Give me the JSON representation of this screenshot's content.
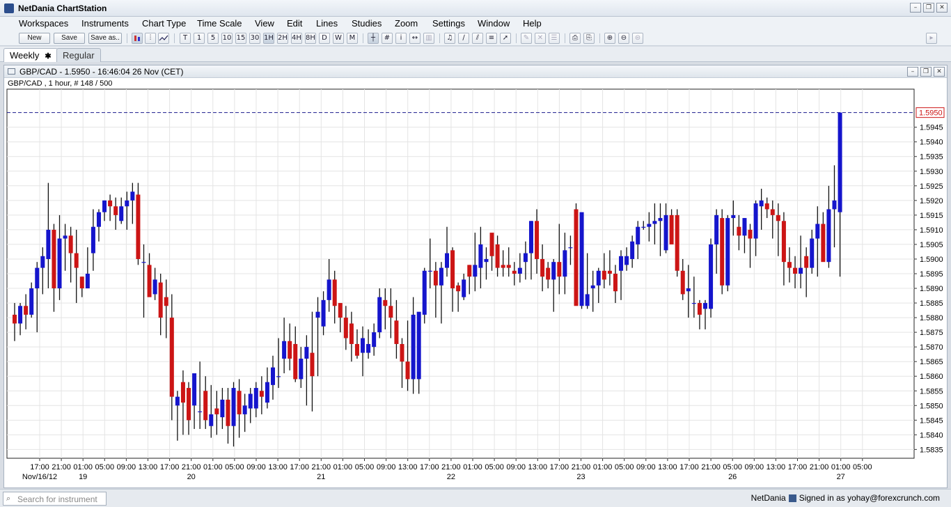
{
  "app": {
    "title": "NetDania ChartStation"
  },
  "window_controls": {
    "minimize": "–",
    "restore": "❐",
    "close": "✕"
  },
  "menu": [
    "Workspaces",
    "Instruments",
    "Chart Type",
    "Time Scale",
    "View",
    "Edit",
    "Lines",
    "Studies",
    "Zoom",
    "Settings",
    "Window",
    "Help"
  ],
  "toolbar": {
    "new_label": "New",
    "save_label": "Save",
    "save_as_label": "Save as..",
    "timeframes": [
      "T",
      "1",
      "5",
      "10",
      "15",
      "30",
      "1H",
      "2H",
      "4H",
      "8H",
      "D",
      "W",
      "M"
    ],
    "active_timeframe": "1H"
  },
  "tabs": [
    {
      "label": "Weekly",
      "close": "✱"
    },
    {
      "label": "Regular"
    }
  ],
  "chart_window": {
    "title": "GBP/CAD - 1.5950 - 16:46:04  26 Nov (CET)",
    "subtitle": "GBP/CAD , 1 hour, # 148 / 500"
  },
  "chart_data": {
    "type": "candlestick",
    "instrument": "GBP/CAD",
    "last_price": "1.5950",
    "up_color": "#1515cc",
    "down_color": "#cc1515",
    "ylim": [
      1.5832,
      1.5958
    ],
    "y_ticks": [
      "1.5945",
      "1.5940",
      "1.5935",
      "1.5930",
      "1.5925",
      "1.5920",
      "1.5915",
      "1.5910",
      "1.5905",
      "1.5900",
      "1.5895",
      "1.5890",
      "1.5885",
      "1.5880",
      "1.5875",
      "1.5870",
      "1.5865",
      "1.5860",
      "1.5855",
      "1.5850",
      "1.5845",
      "1.5840",
      "1.5835"
    ],
    "x_ticks": [
      "17:00",
      "21:00",
      "01:00",
      "05:00",
      "09:00",
      "13:00",
      "17:00",
      "21:00",
      "01:00",
      "05:00",
      "09:00",
      "13:00",
      "17:00",
      "21:00",
      "01:00",
      "05:00",
      "09:00",
      "13:00",
      "17:00",
      "21:00",
      "01:00",
      "05:00",
      "09:00",
      "13:00",
      "17:00",
      "21:00",
      "01:00",
      "05:00",
      "09:00",
      "13:00",
      "17:00",
      "21:00",
      "05:00",
      "09:00",
      "13:00",
      "17:00",
      "21:00",
      "01:00",
      "05:00"
    ],
    "date_labels": [
      {
        "label": "Nov/16/12",
        "tick": 0
      },
      {
        "label": "19",
        "tick": 2
      },
      {
        "label": "20",
        "tick": 7
      },
      {
        "label": "21",
        "tick": 13
      },
      {
        "label": "22",
        "tick": 19
      },
      {
        "label": "23",
        "tick": 25
      },
      {
        "label": "26",
        "tick": 32
      },
      {
        "label": "27",
        "tick": 37
      }
    ],
    "candles": [
      [
        1.5881,
        1.5885,
        1.5872,
        1.5878
      ],
      [
        1.5878,
        1.5885,
        1.5874,
        1.5884
      ],
      [
        1.5884,
        1.5888,
        1.5876,
        1.5881
      ],
      [
        1.5881,
        1.5892,
        1.588,
        1.589
      ],
      [
        1.589,
        1.5899,
        1.5875,
        1.5897
      ],
      [
        1.5897,
        1.5904,
        1.5888,
        1.5901
      ],
      [
        1.59,
        1.5926,
        1.589,
        1.591
      ],
      [
        1.591,
        1.5912,
        1.5882,
        1.589
      ],
      [
        1.589,
        1.5915,
        1.5886,
        1.5907
      ],
      [
        1.5907,
        1.5912,
        1.5896,
        1.5908
      ],
      [
        1.5908,
        1.5911,
        1.5892,
        1.5902
      ],
      [
        1.5902,
        1.591,
        1.5885,
        1.5897
      ],
      [
        1.5894,
        1.5894,
        1.5887,
        1.589
      ],
      [
        1.589,
        1.5904,
        1.589,
        1.5895
      ],
      [
        1.5902,
        1.5917,
        1.5896,
        1.5911
      ],
      [
        1.5911,
        1.5917,
        1.5906,
        1.5916
      ],
      [
        1.5916,
        1.592,
        1.5913,
        1.592
      ],
      [
        1.592,
        1.5922,
        1.5913,
        1.5918
      ],
      [
        1.5918,
        1.5921,
        1.591,
        1.5915
      ],
      [
        1.5913,
        1.5921,
        1.5912,
        1.5918
      ],
      [
        1.5918,
        1.5923,
        1.591,
        1.592
      ],
      [
        1.592,
        1.5926,
        1.5912,
        1.5923
      ],
      [
        1.5922,
        1.5926,
        1.5898,
        1.59
      ],
      [
        1.5899,
        1.5905,
        1.588,
        1.5899
      ],
      [
        1.5898,
        1.5902,
        1.5888,
        1.5887
      ],
      [
        1.5888,
        1.5897,
        1.5886,
        1.5893
      ],
      [
        1.5892,
        1.5895,
        1.5874,
        1.588
      ],
      [
        1.5887,
        1.5893,
        1.5873,
        1.5884
      ],
      [
        1.588,
        1.5888,
        1.5845,
        1.5853
      ],
      [
        1.585,
        1.5855,
        1.5838,
        1.5853
      ],
      [
        1.5858,
        1.5862,
        1.584,
        1.5851
      ],
      [
        1.5856,
        1.5858,
        1.584,
        1.5845
      ],
      [
        1.585,
        1.5855,
        1.5842,
        1.5861
      ],
      [
        1.5848,
        1.5865,
        1.5842,
        1.5848
      ],
      [
        1.5855,
        1.586,
        1.5842,
        1.5845
      ],
      [
        1.5843,
        1.5857,
        1.5839,
        1.5847
      ],
      [
        1.5849,
        1.5855,
        1.584,
        1.5847
      ],
      [
        1.5846,
        1.5856,
        1.5842,
        1.5852
      ],
      [
        1.5852,
        1.5856,
        1.5837,
        1.5843
      ],
      [
        1.5843,
        1.5858,
        1.5836,
        1.5856
      ],
      [
        1.5855,
        1.5859,
        1.5839,
        1.5847
      ],
      [
        1.5847,
        1.5854,
        1.5841,
        1.585
      ],
      [
        1.5849,
        1.5856,
        1.5844,
        1.5854
      ],
      [
        1.5849,
        1.5858,
        1.5846,
        1.5856
      ],
      [
        1.5855,
        1.586,
        1.5847,
        1.5853
      ],
      [
        1.5851,
        1.5863,
        1.5849,
        1.5858
      ],
      [
        1.5857,
        1.5867,
        1.5852,
        1.5863
      ],
      [
        1.586,
        1.5873,
        1.5856,
        1.586
      ],
      [
        1.5866,
        1.588,
        1.5861,
        1.5872
      ],
      [
        1.5872,
        1.5878,
        1.5862,
        1.5866
      ],
      [
        1.5871,
        1.5877,
        1.5858,
        1.5859
      ],
      [
        1.5859,
        1.587,
        1.5856,
        1.5866
      ],
      [
        1.5866,
        1.5874,
        1.585,
        1.587
      ],
      [
        1.5868,
        1.5882,
        1.5848,
        1.586
      ],
      [
        1.588,
        1.5887,
        1.586,
        1.5882
      ],
      [
        1.5877,
        1.5889,
        1.5874,
        1.5886
      ],
      [
        1.5886,
        1.59,
        1.5882,
        1.5893
      ],
      [
        1.5893,
        1.5896,
        1.5878,
        1.5884
      ],
      [
        1.5885,
        1.5884,
        1.5875,
        1.588
      ],
      [
        1.588,
        1.5884,
        1.5869,
        1.5873
      ],
      [
        1.5878,
        1.5882,
        1.5865,
        1.5871
      ],
      [
        1.5871,
        1.5876,
        1.5866,
        1.5867
      ],
      [
        1.5868,
        1.5877,
        1.586,
        1.5873
      ],
      [
        1.5868,
        1.5876,
        1.5866,
        1.5871
      ],
      [
        1.587,
        1.5878,
        1.5867,
        1.5875
      ],
      [
        1.5875,
        1.589,
        1.5873,
        1.5887
      ],
      [
        1.5886,
        1.589,
        1.5876,
        1.5884
      ],
      [
        1.5884,
        1.589,
        1.5873,
        1.588
      ],
      [
        1.5879,
        1.5886,
        1.5866,
        1.5871
      ],
      [
        1.5871,
        1.5873,
        1.5856,
        1.5865
      ],
      [
        1.5865,
        1.5879,
        1.5855,
        1.5859
      ],
      [
        1.5859,
        1.5887,
        1.5854,
        1.5881
      ],
      [
        1.5859,
        1.5877,
        1.5854,
        1.5882
      ],
      [
        1.5881,
        1.5897,
        1.5878,
        1.5896
      ],
      [
        1.5896,
        1.5907,
        1.589,
        1.5896
      ],
      [
        1.5896,
        1.5899,
        1.588,
        1.5891
      ],
      [
        1.5891,
        1.5899,
        1.5878,
        1.5897
      ],
      [
        1.5897,
        1.5911,
        1.5894,
        1.5902
      ],
      [
        1.5903,
        1.5904,
        1.5882,
        1.589
      ],
      [
        1.5891,
        1.5892,
        1.5882,
        1.5889
      ],
      [
        1.5887,
        1.5895,
        1.5886,
        1.5893
      ],
      [
        1.5898,
        1.5898,
        1.5888,
        1.5894
      ],
      [
        1.5894,
        1.5909,
        1.5889,
        1.5898
      ],
      [
        1.5897,
        1.5911,
        1.589,
        1.5905
      ],
      [
        1.5899,
        1.5904,
        1.5893,
        1.59
      ],
      [
        1.5909,
        1.5903,
        1.5896,
        1.5901
      ],
      [
        1.5905,
        1.5908,
        1.5894,
        1.5897
      ],
      [
        1.5898,
        1.5903,
        1.5894,
        1.5897
      ],
      [
        1.5898,
        1.5904,
        1.5894,
        1.5897
      ],
      [
        1.5896,
        1.5899,
        1.5891,
        1.5895
      ],
      [
        1.5895,
        1.5902,
        1.5892,
        1.5897
      ],
      [
        1.5899,
        1.5906,
        1.5893,
        1.5902
      ],
      [
        1.5902,
        1.5913,
        1.5893,
        1.5913
      ],
      [
        1.5913,
        1.5917,
        1.5895,
        1.59
      ],
      [
        1.59,
        1.5905,
        1.5889,
        1.5894
      ],
      [
        1.5897,
        1.5899,
        1.589,
        1.5893
      ],
      [
        1.5893,
        1.59,
        1.5882,
        1.5899
      ],
      [
        1.5899,
        1.5912,
        1.5888,
        1.5894
      ],
      [
        1.5894,
        1.5909,
        1.5888,
        1.5903
      ],
      [
        1.5904,
        1.5908,
        1.5898,
        1.5904
      ],
      [
        1.5917,
        1.5919,
        1.5886,
        1.5884
      ],
      [
        1.5884,
        1.5911,
        1.5883,
        1.5916
      ],
      [
        1.5884,
        1.5902,
        1.5883,
        1.5888
      ],
      [
        1.589,
        1.5896,
        1.5882,
        1.5891
      ],
      [
        1.5891,
        1.5897,
        1.5885,
        1.5896
      ],
      [
        1.5896,
        1.5902,
        1.589,
        1.5893
      ],
      [
        1.5896,
        1.5903,
        1.5891,
        1.5895
      ],
      [
        1.5895,
        1.5898,
        1.5885,
        1.5889
      ],
      [
        1.5896,
        1.5903,
        1.5886,
        1.5901
      ],
      [
        1.5898,
        1.5904,
        1.5896,
        1.5901
      ],
      [
        1.59,
        1.5908,
        1.5897,
        1.5906
      ],
      [
        1.5905,
        1.5913,
        1.59,
        1.5911
      ],
      [
        1.5911,
        1.5913,
        1.591,
        1.5911
      ],
      [
        1.5911,
        1.5916,
        1.5906,
        1.5912
      ],
      [
        1.5912,
        1.5919,
        1.5905,
        1.5913
      ],
      [
        1.5913,
        1.5919,
        1.5901,
        1.5914
      ],
      [
        1.5903,
        1.5919,
        1.5902,
        1.5915
      ],
      [
        1.5915,
        1.5917,
        1.5906,
        1.5905
      ],
      [
        1.5915,
        1.5917,
        1.5894,
        1.5896
      ],
      [
        1.5896,
        1.59,
        1.5886,
        1.5888
      ],
      [
        1.5889,
        1.5898,
        1.588,
        1.589
      ],
      [
        1.5885,
        1.5894,
        1.588,
        1.5885
      ],
      [
        1.5885,
        1.5886,
        1.5876,
        1.5881
      ],
      [
        1.5883,
        1.5886,
        1.5876,
        1.5885
      ],
      [
        1.5883,
        1.5907,
        1.588,
        1.5905
      ],
      [
        1.5905,
        1.5917,
        1.5895,
        1.5915
      ],
      [
        1.5914,
        1.5917,
        1.5888,
        1.5891
      ],
      [
        1.5891,
        1.5915,
        1.5889,
        1.5914
      ],
      [
        1.5914,
        1.592,
        1.5908,
        1.5915
      ],
      [
        1.5911,
        1.5915,
        1.5903,
        1.5908
      ],
      [
        1.5908,
        1.5914,
        1.5902,
        1.5914
      ],
      [
        1.591,
        1.5912,
        1.5897,
        1.5907
      ],
      [
        1.5907,
        1.592,
        1.5901,
        1.5919
      ],
      [
        1.5918,
        1.5924,
        1.591,
        1.592
      ],
      [
        1.5919,
        1.5921,
        1.5914,
        1.5917
      ],
      [
        1.5917,
        1.592,
        1.5907,
        1.5915
      ],
      [
        1.5915,
        1.5919,
        1.5901,
        1.5913
      ],
      [
        1.5913,
        1.5916,
        1.5891,
        1.5899
      ],
      [
        1.5899,
        1.5904,
        1.5892,
        1.5897
      ],
      [
        1.5897,
        1.5901,
        1.589,
        1.5895
      ],
      [
        1.5895,
        1.5908,
        1.589,
        1.5897
      ],
      [
        1.5901,
        1.5904,
        1.5887,
        1.5897
      ],
      [
        1.5897,
        1.591,
        1.5895,
        1.5907
      ],
      [
        1.5907,
        1.5918,
        1.5894,
        1.5912
      ],
      [
        1.5912,
        1.5916,
        1.59,
        1.5899
      ],
      [
        1.5899,
        1.5925,
        1.5897,
        1.5917
      ],
      [
        1.5917,
        1.5932,
        1.5904,
        1.592
      ],
      [
        1.5916,
        1.595,
        1.5894,
        1.595
      ]
    ]
  },
  "status": {
    "search_placeholder": "Search for instrument",
    "brand": "NetDania",
    "signed_in": "Signed in as yohay@forexcrunch.com"
  }
}
